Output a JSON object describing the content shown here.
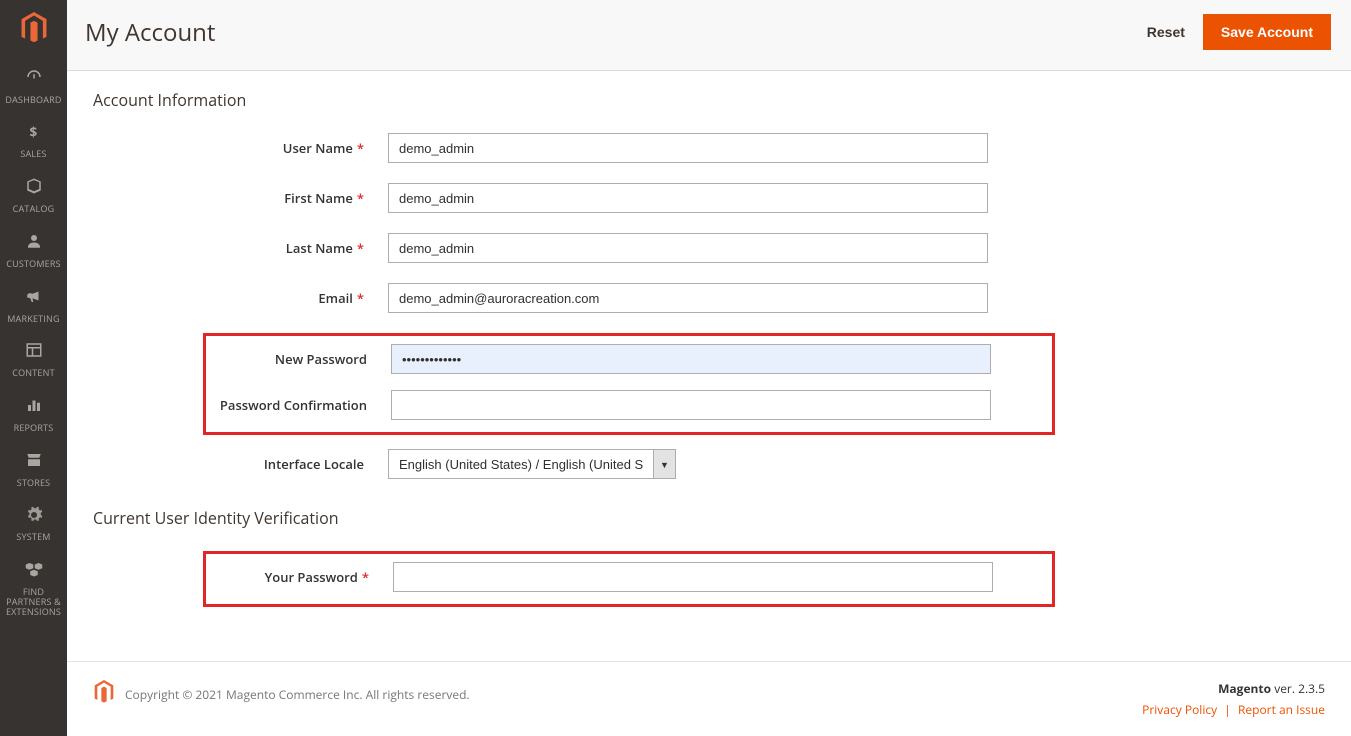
{
  "sidebar": {
    "items": [
      {
        "label": "DASHBOARD",
        "icon": "dashboard"
      },
      {
        "label": "SALES",
        "icon": "dollar"
      },
      {
        "label": "CATALOG",
        "icon": "box"
      },
      {
        "label": "CUSTOMERS",
        "icon": "person"
      },
      {
        "label": "MARKETING",
        "icon": "megaphone"
      },
      {
        "label": "CONTENT",
        "icon": "layout"
      },
      {
        "label": "REPORTS",
        "icon": "bars"
      },
      {
        "label": "STORES",
        "icon": "storefront"
      },
      {
        "label": "SYSTEM",
        "icon": "gear"
      },
      {
        "label": "FIND PARTNERS & EXTENSIONS",
        "icon": "cubes"
      }
    ]
  },
  "header": {
    "title": "My Account",
    "reset_label": "Reset",
    "save_label": "Save Account"
  },
  "sections": {
    "account_info": "Account Information",
    "identity": "Current User Identity Verification"
  },
  "fields": {
    "username": {
      "label": "User Name",
      "value": "demo_admin"
    },
    "firstname": {
      "label": "First Name",
      "value": "demo_admin"
    },
    "lastname": {
      "label": "Last Name",
      "value": "demo_admin"
    },
    "email": {
      "label": "Email",
      "value": "demo_admin@auroracreation.com"
    },
    "newpassword": {
      "label": "New Password",
      "value": "•••••••••••••"
    },
    "confirm": {
      "label": "Password Confirmation",
      "value": ""
    },
    "locale": {
      "label": "Interface Locale",
      "value": "English (United States) / English (United States)"
    },
    "yourpassword": {
      "label": "Your Password",
      "value": ""
    }
  },
  "footer": {
    "copyright": "Copyright © 2021 Magento Commerce Inc. All rights reserved.",
    "product": "Magento",
    "version": " ver. 2.3.5",
    "privacy": "Privacy Policy",
    "report": "Report an Issue"
  }
}
